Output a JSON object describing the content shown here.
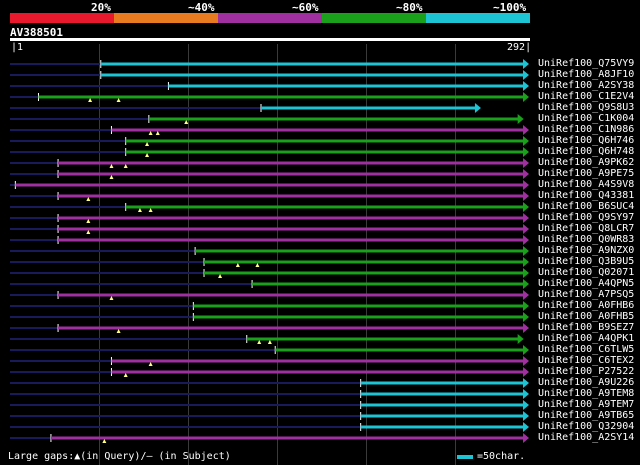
{
  "legend": {
    "items": [
      {
        "label": "20%",
        "color": "#e8192c"
      },
      {
        "label": "~40%",
        "color": "#e87a20"
      },
      {
        "label": "~60%",
        "color": "#a030a0"
      },
      {
        "label": "~80%",
        "color": "#1aa01a"
      },
      {
        "label": "~100%",
        "color": "#1dc4d4"
      }
    ]
  },
  "query": {
    "name": "AV388501",
    "start": "1",
    "end": "292",
    "length": 292
  },
  "hits": [
    {
      "name": "UniRef100_Q75VY9",
      "color": "cyan",
      "start": 52,
      "gaps": []
    },
    {
      "name": "UniRef100_A8JF10",
      "color": "cyan",
      "start": 52,
      "gaps": []
    },
    {
      "name": "UniRef100_A2SY38",
      "color": "cyan",
      "start": 90,
      "gaps": []
    },
    {
      "name": "UniRef100_C1E2V4",
      "color": "green",
      "start": 17,
      "gaps": [
        46,
        62
      ]
    },
    {
      "name": "UniRef100_Q9S8U3",
      "color": "cyan",
      "start": 142,
      "end": 265,
      "gaps": []
    },
    {
      "name": "UniRef100_C1K004",
      "color": "green",
      "start": 79,
      "end": 289,
      "gaps": [
        100
      ]
    },
    {
      "name": "UniRef100_C1N986",
      "color": "purple",
      "start": 58,
      "gaps": [
        80,
        84
      ]
    },
    {
      "name": "UniRef100_Q6H746",
      "color": "green",
      "start": 66,
      "gaps": [
        78
      ]
    },
    {
      "name": "UniRef100_Q6H748",
      "color": "green",
      "start": 66,
      "gaps": [
        78
      ]
    },
    {
      "name": "UniRef100_A9PK62",
      "color": "purple",
      "start": 28,
      "gaps": [
        58,
        66
      ]
    },
    {
      "name": "UniRef100_A9PE75",
      "color": "purple",
      "start": 28,
      "gaps": [
        58
      ]
    },
    {
      "name": "UniRef100_A4S9V8",
      "color": "purple",
      "start": 4,
      "gaps": []
    },
    {
      "name": "UniRef100_Q43381",
      "color": "purple",
      "start": 28,
      "gaps": [
        45
      ]
    },
    {
      "name": "UniRef100_B6SUC4",
      "color": "green",
      "start": 66,
      "gaps": [
        74,
        80
      ]
    },
    {
      "name": "UniRef100_Q9SY97",
      "color": "purple",
      "start": 28,
      "gaps": [
        45
      ]
    },
    {
      "name": "UniRef100_Q8LCR7",
      "color": "purple",
      "start": 28,
      "gaps": [
        45
      ]
    },
    {
      "name": "UniRef100_Q0WR83",
      "color": "purple",
      "start": 28,
      "gaps": []
    },
    {
      "name": "UniRef100_A9NZX0",
      "color": "green",
      "start": 105,
      "gaps": []
    },
    {
      "name": "UniRef100_Q3B9U5",
      "color": "green",
      "start": 110,
      "gaps": [
        129,
        140
      ]
    },
    {
      "name": "UniRef100_Q02071",
      "color": "green",
      "start": 110,
      "gaps": [
        119
      ]
    },
    {
      "name": "UniRef100_A4QPN5",
      "color": "green",
      "start": 137,
      "gaps": []
    },
    {
      "name": "UniRef100_A7PSQ5",
      "color": "purple",
      "start": 28,
      "gaps": [
        58
      ]
    },
    {
      "name": "UniRef100_A0FHB6",
      "color": "green",
      "start": 104,
      "gaps": []
    },
    {
      "name": "UniRef100_A0FHB5",
      "color": "green",
      "start": 104,
      "gaps": []
    },
    {
      "name": "UniRef100_B9SEZ7",
      "color": "purple",
      "start": 28,
      "gaps": [
        62
      ]
    },
    {
      "name": "UniRef100_A4QPK1",
      "color": "green",
      "start": 134,
      "end": 289,
      "gaps": [
        141,
        147
      ]
    },
    {
      "name": "UniRef100_C6TLW5",
      "color": "green",
      "start": 150,
      "gaps": []
    },
    {
      "name": "UniRef100_C6TEX2",
      "color": "purple",
      "start": 58,
      "gaps": [
        80
      ]
    },
    {
      "name": "UniRef100_P27522",
      "color": "purple",
      "start": 58,
      "gaps": [
        66
      ]
    },
    {
      "name": "UniRef100_A9U226",
      "color": "cyan",
      "start": 198,
      "gaps": []
    },
    {
      "name": "UniRef100_A9TEM8",
      "color": "cyan",
      "start": 198,
      "gaps": []
    },
    {
      "name": "UniRef100_A9TEM7",
      "color": "cyan",
      "start": 198,
      "gaps": []
    },
    {
      "name": "UniRef100_A9TB65",
      "color": "cyan",
      "start": 198,
      "gaps": []
    },
    {
      "name": "UniRef100_Q32904",
      "color": "cyan",
      "start": 198,
      "gaps": []
    },
    {
      "name": "UniRef100_A2SY14",
      "color": "purple",
      "start": 24,
      "gaps": [
        54
      ]
    }
  ],
  "footer": {
    "gaps_text": "Large gaps:▲(in Query)/– (in Subject)",
    "scale_text": "=50char."
  }
}
